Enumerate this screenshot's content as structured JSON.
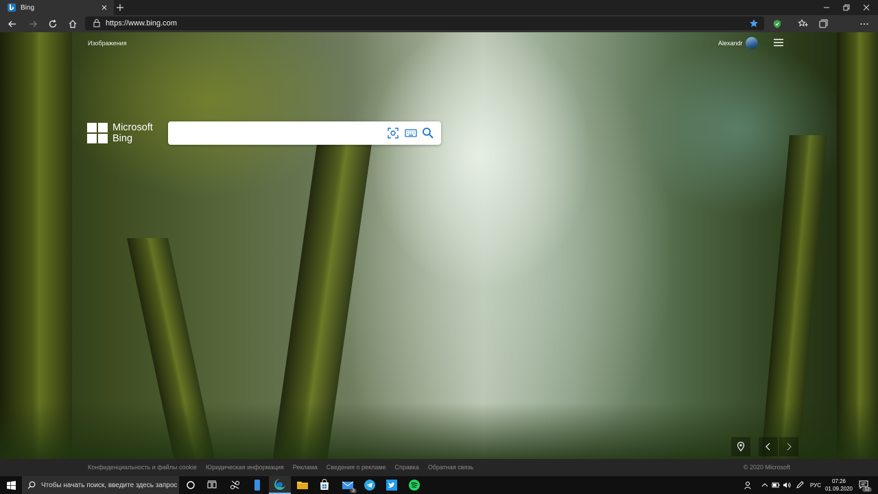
{
  "browser": {
    "tab_title": "Bing",
    "url": "https://www.bing.com"
  },
  "header": {
    "images_link": "Изображения",
    "user_name": "Alexandr"
  },
  "logo": {
    "line1": "Microsoft",
    "line2": "Bing"
  },
  "search": {
    "placeholder": "",
    "value": ""
  },
  "footer": {
    "links": [
      "Конфиденциальность и файлы cookie",
      "Юридическая информация",
      "Реклама",
      "Сведения о рекламе",
      "Справка",
      "Обратная связь"
    ],
    "copyright": "© 2020 Microsoft"
  },
  "taskbar": {
    "search_placeholder": "Чтобы начать поиск, введите здесь запрос",
    "mail_badge": "3",
    "language": "РУС",
    "time": "07:26",
    "date": "01.09.2020",
    "notifications_count": "12"
  },
  "colors": {
    "accent": "#1c78c0",
    "search_icon_blue": "#1a73c9",
    "taskbar_bg": "#101010"
  }
}
